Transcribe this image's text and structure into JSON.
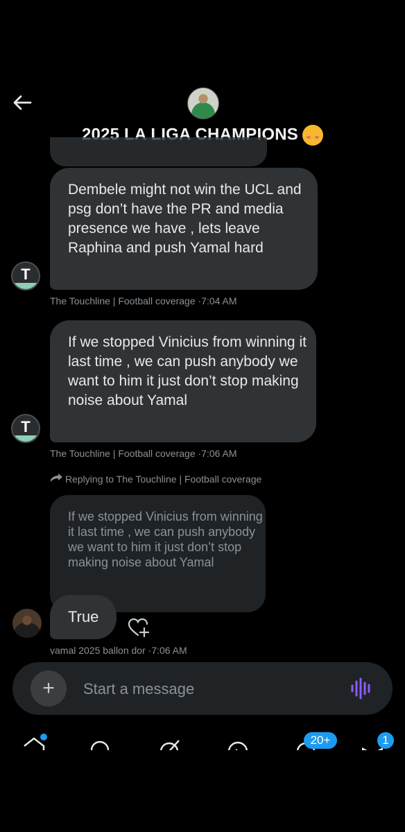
{
  "header": {
    "title": "2025 LA LIGA CHAMPIONS",
    "emoji": "partying-face"
  },
  "messages": [
    {
      "text": "Dembele might not win the UCL and psg don’t have the PR and media presence we have , lets leave Raphina and push Yamal hard",
      "sender": "The Touchline | Football coverage",
      "time": "·7:04 AM"
    },
    {
      "text": "If we stopped Vinicius from winning it last time , we can push anybody we want to him it just don’t stop making noise about Yamal",
      "sender": "The Touchline | Football coverage",
      "time": "·7:06 AM"
    },
    {
      "reply_label": "Replying to The Touchline | Football coverage",
      "quoted_text": "If we stopped Vinicius from winning it last time , we can push anybody we want to him it just don’t stop making noise about Yamal",
      "text": "True",
      "sender": "yamal 2025 ballon dor",
      "time": "·7:06 AM"
    }
  ],
  "composer": {
    "placeholder": "Start a message",
    "plus": "+"
  },
  "nav": {
    "messages_badge": "20+",
    "mail_badge": "1"
  },
  "colors": {
    "background": "#000000",
    "bubble": "#2f3336",
    "accent": "#1d9bf0",
    "voice": "#8b5cf6"
  }
}
